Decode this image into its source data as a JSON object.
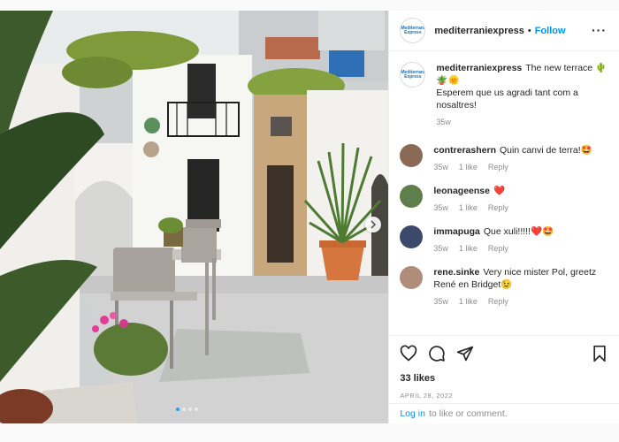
{
  "header": {
    "username": "mediterraniexpress",
    "separator": "•",
    "follow_label": "Follow",
    "more_label": "···",
    "logo_text": "Mediterrani Express"
  },
  "caption": {
    "username": "mediterraniexpress",
    "text": "The new terrace 🌵🪴🌞",
    "text2": "Esperem que us agradi tant com a nosaltres!",
    "time": "35w"
  },
  "comments": [
    {
      "username": "contrerashern",
      "text": "Quin canvi de terra!🤩",
      "time": "35w",
      "likes": "1 like",
      "reply": "Reply",
      "avatar_color": "#8a6a55"
    },
    {
      "username": "leonageense",
      "text": "❤️",
      "time": "35w",
      "likes": "1 like",
      "reply": "Reply",
      "avatar_color": "#5f7e4b"
    },
    {
      "username": "immapuga",
      "text": "Que xuli!!!!!❤️🤩",
      "time": "35w",
      "likes": "1 like",
      "reply": "Reply",
      "avatar_color": "#3b4a6b"
    },
    {
      "username": "rene.sinke",
      "text": "Very nice mister Pol, greetz René en Bridget😉",
      "time": "35w",
      "likes": "1 like",
      "reply": "Reply",
      "avatar_color": "#b08d7a"
    }
  ],
  "likes_text": "33 likes",
  "date_text": "APRIL 28, 2022",
  "login": {
    "link_label": "Log in",
    "rest_text": "to like or comment."
  },
  "colors": {
    "accent": "#0095f6",
    "muted": "#8e8e8e",
    "active_dot": "#1f9ef5"
  },
  "icons": [
    "heart-icon",
    "comment-icon",
    "share-icon",
    "bookmark-icon",
    "chevron-right-icon"
  ],
  "carousel": {
    "count": 4,
    "active_index": 0
  }
}
